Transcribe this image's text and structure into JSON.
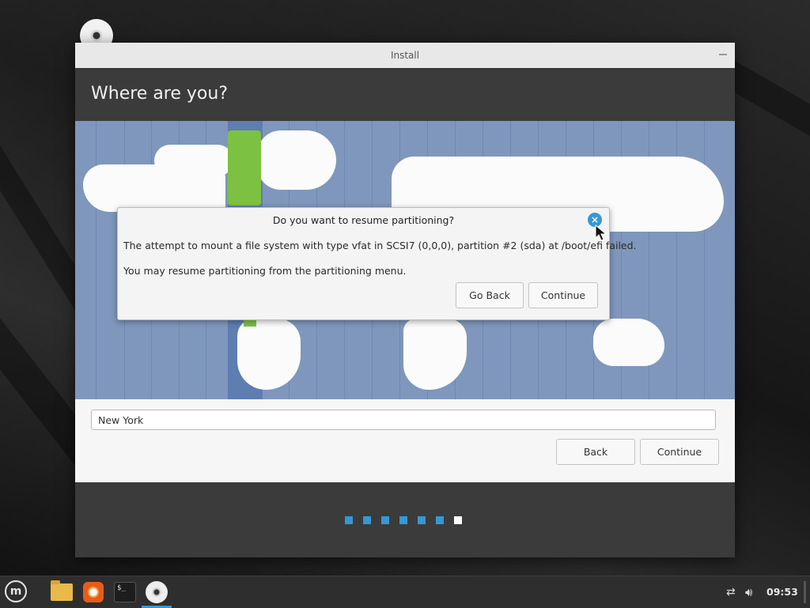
{
  "window": {
    "title": "Install",
    "header_title": "Where are you?"
  },
  "location": {
    "value": "New York"
  },
  "buttons": {
    "back": "Back",
    "continue": "Continue"
  },
  "progress": {
    "total_steps": 7,
    "current_step": 7
  },
  "dialog": {
    "title": "Do you want to resume partitioning?",
    "message1": "The attempt to mount a file system with type vfat in SCSI7 (0,0,0), partition #2 (sda) at /boot/efi failed.",
    "message2": "You may resume partitioning from the partitioning menu.",
    "go_back": "Go Back",
    "continue": "Continue",
    "close_glyph": "×"
  },
  "taskbar": {
    "menu_glyph": "m",
    "terminal_glyph": "$_",
    "clock": "09:53",
    "accent_color": "#3598d4"
  }
}
